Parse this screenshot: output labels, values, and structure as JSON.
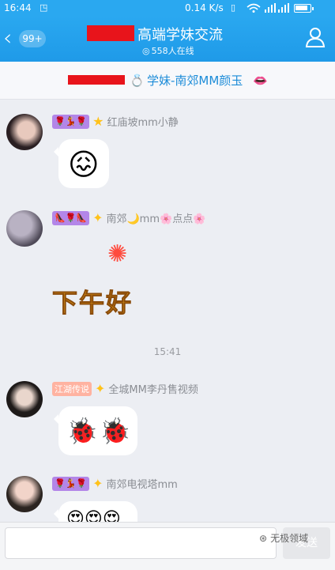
{
  "status_bar": {
    "time": "16:44",
    "net_speed": "0.14 K/s",
    "battery_level": 0.85
  },
  "header": {
    "unread_count": "99+",
    "title": "高端学妹交流",
    "online_text": "558人在线"
  },
  "notice": {
    "text": "学妹-南郊MM颜玉"
  },
  "messages": [
    {
      "badges": [
        "🌹💃🌹"
      ],
      "name": "红庙坡mm小静",
      "emoji": "😖"
    },
    {
      "badges": [
        "👠🌹👠"
      ],
      "name": "南郊🌙mm🌸点点🌸",
      "sticker": "下午好"
    },
    {
      "badges": [
        "江湖传说"
      ],
      "name": "全城MM李丹售视频",
      "emoji": "🐞🐞"
    },
    {
      "badges": [
        "🌹💃🌹"
      ],
      "name": "南郊电视塔mm",
      "emoji": "😍😍😍"
    }
  ],
  "timestamp": "15:41",
  "input": {
    "placeholder": "",
    "send_label": "发送"
  },
  "watermark": "无极领域",
  "colors": {
    "header": "#2aa8f0",
    "notice_text": "#1d8cd8",
    "redaction": "#e8141b"
  }
}
